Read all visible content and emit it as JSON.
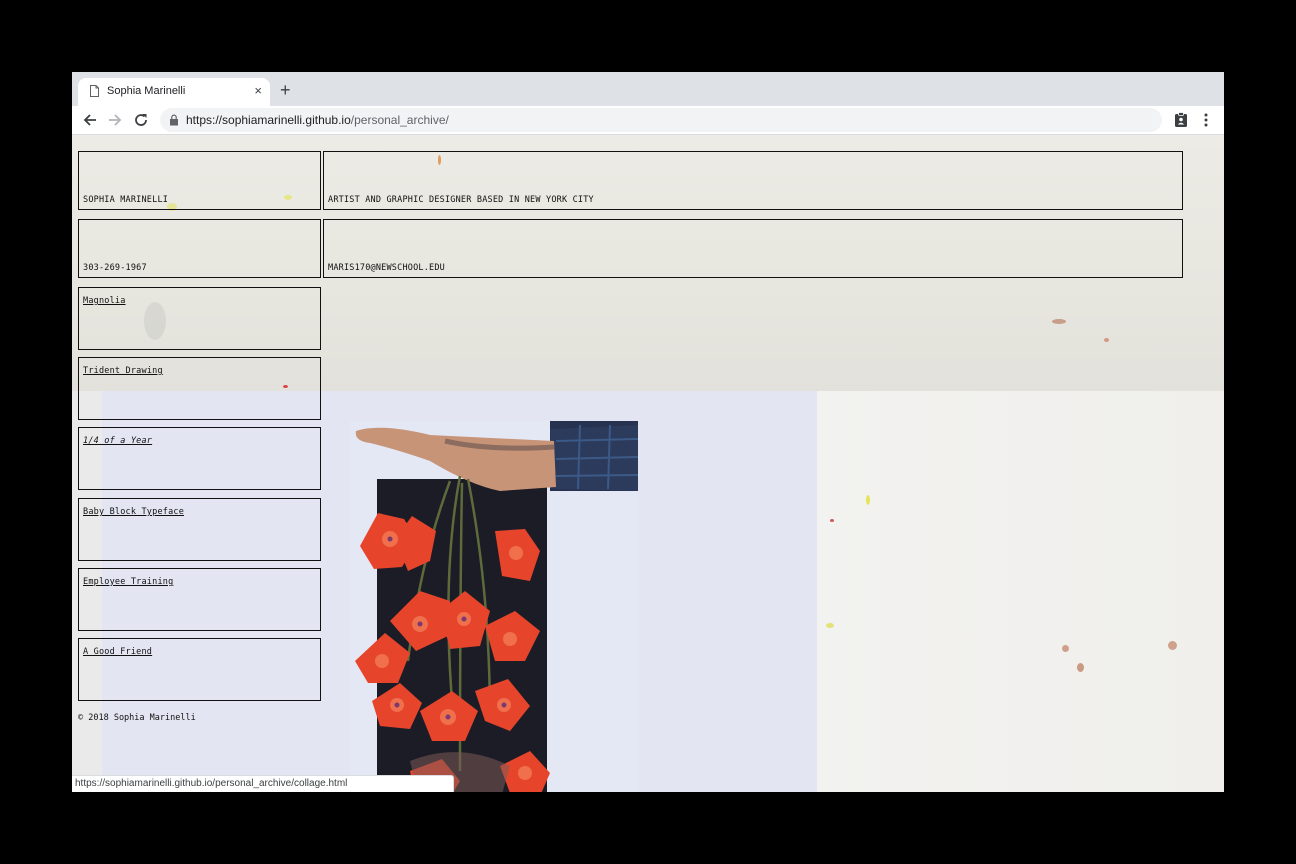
{
  "browser": {
    "tab_title": "Sophia Marinelli",
    "tab_close": "×",
    "new_tab": "+",
    "url_host": "https://sophiamarinelli.github.io",
    "url_path": "/personal_archive/",
    "status_url": "https://sophiamarinelli.github.io/personal_archive/collage.html"
  },
  "header": {
    "name": "SOPHIA MARINELLI",
    "tagline": "ARTIST AND GRAPHIC DESIGNER BASED IN NEW YORK CITY",
    "phone": "303-269-1967",
    "email": "MARIS170@NEWSCHOOL.EDU"
  },
  "projects": [
    {
      "label": "Magnolia"
    },
    {
      "label": "Trident Drawing"
    },
    {
      "label": "1/4 of a Year"
    },
    {
      "label": "Baby Block Typeface"
    },
    {
      "label": "Employee Training"
    },
    {
      "label": "A Good Friend"
    }
  ],
  "footer": {
    "copyright": "© 2018 Sophia Marinelli"
  }
}
